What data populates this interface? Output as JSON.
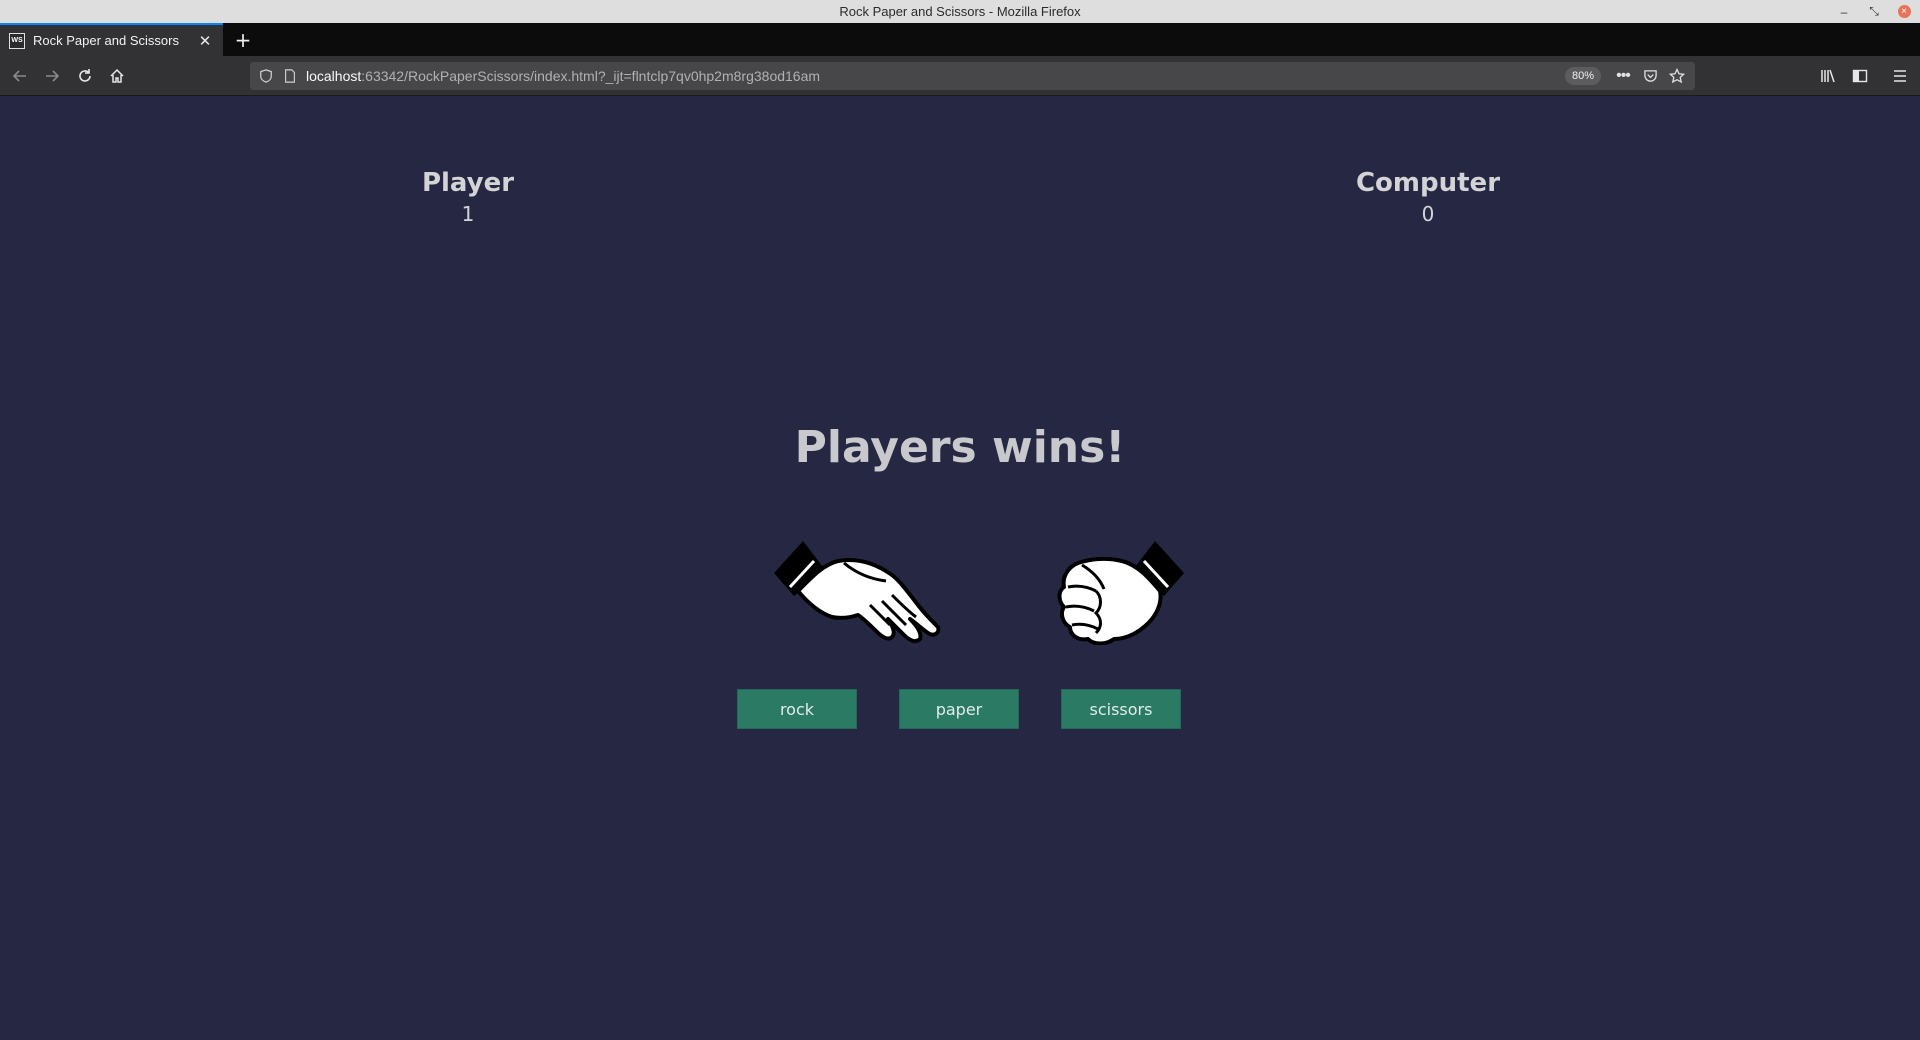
{
  "window": {
    "title": "Rock Paper and Scissors - Mozilla Firefox",
    "controls": {
      "minimize": "–",
      "restore": "⤡",
      "close": "×"
    }
  },
  "tabs": [
    {
      "favicon": "WS",
      "title": "Rock Paper and Scissors",
      "active": true
    }
  ],
  "toolbar": {
    "url_host": "localhost",
    "url_rest": ":63342/RockPaperScissors/index.html?_ijt=flntclp7qv0hp2m8rg38od16am",
    "zoom": "80%",
    "icons": [
      "back-icon",
      "forward-icon",
      "reload-icon",
      "home-icon",
      "shield-icon",
      "page-icon",
      "more-icon",
      "pocket-icon",
      "star-icon",
      "library-icon",
      "sidebar-icon",
      "menu-icon"
    ]
  },
  "game": {
    "player_label": "Player",
    "player_score": "1",
    "computer_label": "Computer",
    "computer_score": "0",
    "result": "Players wins!",
    "player_choice": "paper",
    "computer_choice": "rock",
    "buttons": [
      "rock",
      "paper",
      "scissors"
    ]
  },
  "colors": {
    "page_background": "#262843",
    "button_background": "#2a7a64",
    "text": "#d4d4d7"
  }
}
